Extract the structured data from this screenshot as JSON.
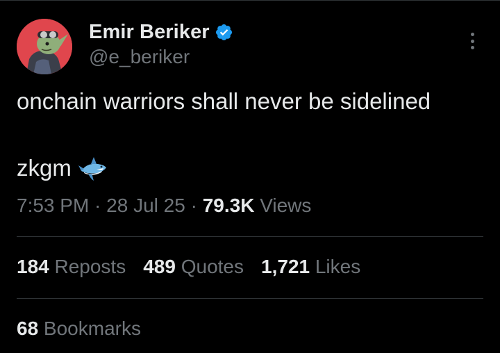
{
  "author": {
    "display_name": "Emir Beriker",
    "handle": "@e_beriker",
    "verified": true,
    "avatar_bg": "#e0464d",
    "verified_color": "#1d9bf0"
  },
  "tweet": {
    "line1": "onchain warriors shall never be sidelined",
    "line2": "zkgm",
    "emoji": "shark-icon"
  },
  "meta": {
    "time": "7:53 PM",
    "sep1": " · ",
    "date": "28 Jul 25",
    "sep2": " · ",
    "views_count": "79.3K",
    "views_label": " Views"
  },
  "stats": {
    "reposts": {
      "count": "184",
      "label": " Reposts"
    },
    "quotes": {
      "count": "489",
      "label": " Quotes"
    },
    "likes": {
      "count": "1,721",
      "label": " Likes"
    },
    "bookmarks": {
      "count": "68",
      "label": " Bookmarks"
    }
  }
}
